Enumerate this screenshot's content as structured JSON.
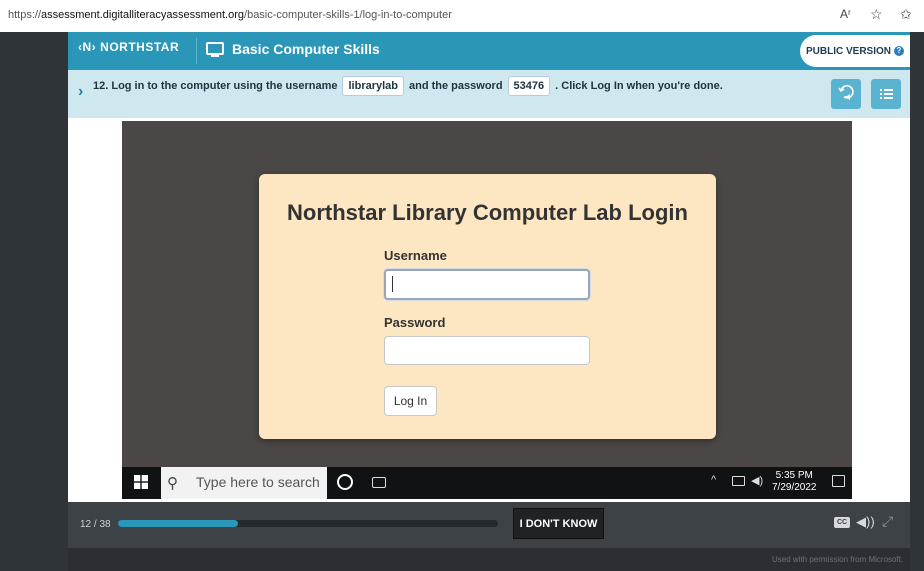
{
  "browser": {
    "url_prefix": "https://",
    "url_domain": "assessment.digitalliteracyassessment.org",
    "url_path": "/basic-computer-skills-1/log-in-to-computer",
    "reader_label": "Aʳ"
  },
  "header": {
    "logo_text": "NORTHSTAR",
    "course_title": "Basic Computer Skills",
    "public_version_label": "PUBLIC VERSION"
  },
  "instruction": {
    "prefix": "12. Log in to the computer using the username",
    "username": "librarylab",
    "middle": "and the password",
    "password": "53476",
    "suffix": ". Click Log In when you're done."
  },
  "login": {
    "title": "Northstar Library Computer Lab Login",
    "username_label": "Username",
    "password_label": "Password",
    "username_value": "",
    "password_value": "",
    "button_label": "Log In"
  },
  "taskbar": {
    "search_placeholder": "Type here to search",
    "time": "5:35 PM",
    "date": "7/29/2022"
  },
  "controls": {
    "progress_text": "12 / 38",
    "progress_current": 12,
    "progress_total": 38,
    "idk_label": "I DON'T KNOW",
    "cc_label": "CC"
  },
  "footer": {
    "permission": "Used with permission from Microsoft."
  },
  "colors": {
    "brand_teal": "#2a96b8",
    "instruction_bg": "#cfe7ef",
    "card_bg": "#fde6c2",
    "desktop_bg": "#4a4746",
    "control_bar": "#3d4247"
  }
}
